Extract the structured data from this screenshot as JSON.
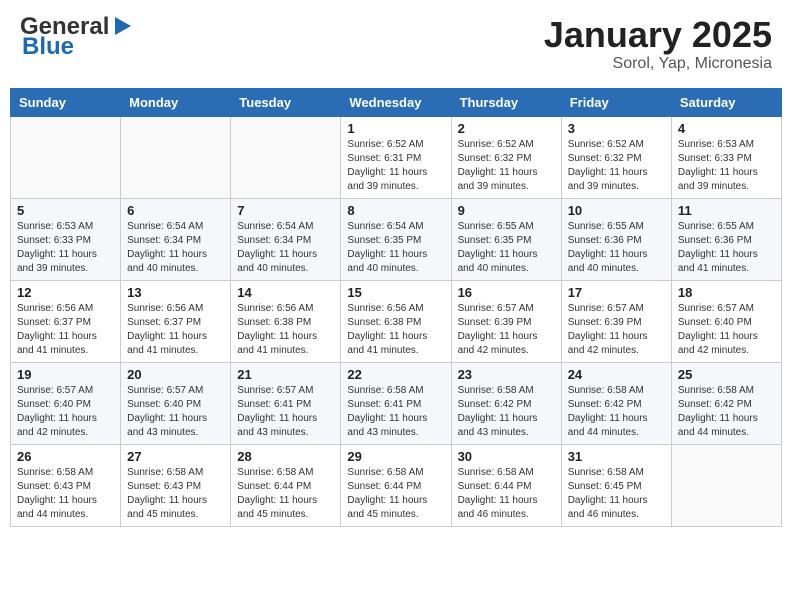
{
  "header": {
    "logo_general": "General",
    "logo_blue": "Blue",
    "title": "January 2025",
    "subtitle": "Sorol, Yap, Micronesia"
  },
  "calendar": {
    "days_of_week": [
      "Sunday",
      "Monday",
      "Tuesday",
      "Wednesday",
      "Thursday",
      "Friday",
      "Saturday"
    ],
    "weeks": [
      [
        {
          "day": "",
          "info": ""
        },
        {
          "day": "",
          "info": ""
        },
        {
          "day": "",
          "info": ""
        },
        {
          "day": "1",
          "info": "Sunrise: 6:52 AM\nSunset: 6:31 PM\nDaylight: 11 hours and 39 minutes."
        },
        {
          "day": "2",
          "info": "Sunrise: 6:52 AM\nSunset: 6:32 PM\nDaylight: 11 hours and 39 minutes."
        },
        {
          "day": "3",
          "info": "Sunrise: 6:52 AM\nSunset: 6:32 PM\nDaylight: 11 hours and 39 minutes."
        },
        {
          "day": "4",
          "info": "Sunrise: 6:53 AM\nSunset: 6:33 PM\nDaylight: 11 hours and 39 minutes."
        }
      ],
      [
        {
          "day": "5",
          "info": "Sunrise: 6:53 AM\nSunset: 6:33 PM\nDaylight: 11 hours and 39 minutes."
        },
        {
          "day": "6",
          "info": "Sunrise: 6:54 AM\nSunset: 6:34 PM\nDaylight: 11 hours and 40 minutes."
        },
        {
          "day": "7",
          "info": "Sunrise: 6:54 AM\nSunset: 6:34 PM\nDaylight: 11 hours and 40 minutes."
        },
        {
          "day": "8",
          "info": "Sunrise: 6:54 AM\nSunset: 6:35 PM\nDaylight: 11 hours and 40 minutes."
        },
        {
          "day": "9",
          "info": "Sunrise: 6:55 AM\nSunset: 6:35 PM\nDaylight: 11 hours and 40 minutes."
        },
        {
          "day": "10",
          "info": "Sunrise: 6:55 AM\nSunset: 6:36 PM\nDaylight: 11 hours and 40 minutes."
        },
        {
          "day": "11",
          "info": "Sunrise: 6:55 AM\nSunset: 6:36 PM\nDaylight: 11 hours and 41 minutes."
        }
      ],
      [
        {
          "day": "12",
          "info": "Sunrise: 6:56 AM\nSunset: 6:37 PM\nDaylight: 11 hours and 41 minutes."
        },
        {
          "day": "13",
          "info": "Sunrise: 6:56 AM\nSunset: 6:37 PM\nDaylight: 11 hours and 41 minutes."
        },
        {
          "day": "14",
          "info": "Sunrise: 6:56 AM\nSunset: 6:38 PM\nDaylight: 11 hours and 41 minutes."
        },
        {
          "day": "15",
          "info": "Sunrise: 6:56 AM\nSunset: 6:38 PM\nDaylight: 11 hours and 41 minutes."
        },
        {
          "day": "16",
          "info": "Sunrise: 6:57 AM\nSunset: 6:39 PM\nDaylight: 11 hours and 42 minutes."
        },
        {
          "day": "17",
          "info": "Sunrise: 6:57 AM\nSunset: 6:39 PM\nDaylight: 11 hours and 42 minutes."
        },
        {
          "day": "18",
          "info": "Sunrise: 6:57 AM\nSunset: 6:40 PM\nDaylight: 11 hours and 42 minutes."
        }
      ],
      [
        {
          "day": "19",
          "info": "Sunrise: 6:57 AM\nSunset: 6:40 PM\nDaylight: 11 hours and 42 minutes."
        },
        {
          "day": "20",
          "info": "Sunrise: 6:57 AM\nSunset: 6:40 PM\nDaylight: 11 hours and 43 minutes."
        },
        {
          "day": "21",
          "info": "Sunrise: 6:57 AM\nSunset: 6:41 PM\nDaylight: 11 hours and 43 minutes."
        },
        {
          "day": "22",
          "info": "Sunrise: 6:58 AM\nSunset: 6:41 PM\nDaylight: 11 hours and 43 minutes."
        },
        {
          "day": "23",
          "info": "Sunrise: 6:58 AM\nSunset: 6:42 PM\nDaylight: 11 hours and 43 minutes."
        },
        {
          "day": "24",
          "info": "Sunrise: 6:58 AM\nSunset: 6:42 PM\nDaylight: 11 hours and 44 minutes."
        },
        {
          "day": "25",
          "info": "Sunrise: 6:58 AM\nSunset: 6:42 PM\nDaylight: 11 hours and 44 minutes."
        }
      ],
      [
        {
          "day": "26",
          "info": "Sunrise: 6:58 AM\nSunset: 6:43 PM\nDaylight: 11 hours and 44 minutes."
        },
        {
          "day": "27",
          "info": "Sunrise: 6:58 AM\nSunset: 6:43 PM\nDaylight: 11 hours and 45 minutes."
        },
        {
          "day": "28",
          "info": "Sunrise: 6:58 AM\nSunset: 6:44 PM\nDaylight: 11 hours and 45 minutes."
        },
        {
          "day": "29",
          "info": "Sunrise: 6:58 AM\nSunset: 6:44 PM\nDaylight: 11 hours and 45 minutes."
        },
        {
          "day": "30",
          "info": "Sunrise: 6:58 AM\nSunset: 6:44 PM\nDaylight: 11 hours and 46 minutes."
        },
        {
          "day": "31",
          "info": "Sunrise: 6:58 AM\nSunset: 6:45 PM\nDaylight: 11 hours and 46 minutes."
        },
        {
          "day": "",
          "info": ""
        }
      ]
    ]
  }
}
